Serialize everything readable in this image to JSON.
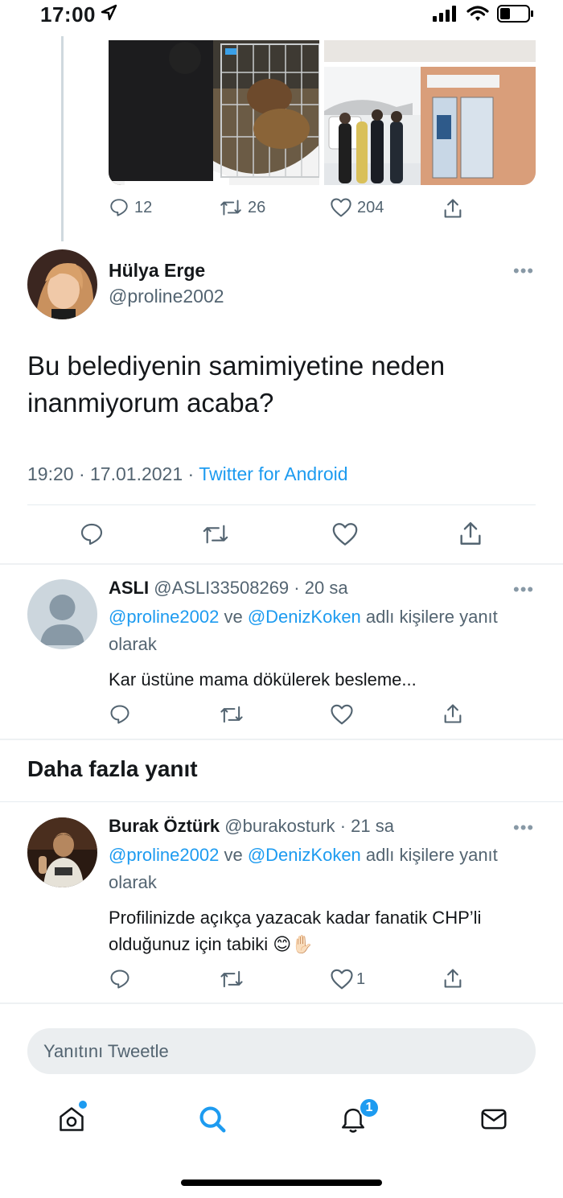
{
  "status_bar": {
    "time": "17:00"
  },
  "top_tweet": {
    "actions": {
      "replies": "12",
      "retweets": "26",
      "likes": "204"
    }
  },
  "main_tweet": {
    "author_name": "Hülya Erge",
    "author_handle": "@proline2002",
    "text": "Bu belediyenin  samimiyetine neden inanmiyorum acaba?",
    "time": "19:20",
    "date": "17.01.2021",
    "separator": "·",
    "source": "Twitter for Android"
  },
  "replies": [
    {
      "author_name": "ASLI",
      "author_handle": "@ASLI33508269",
      "time_ago": "20 sa",
      "mention_1": "@proline2002",
      "joiner": "ve",
      "mention_2": "@DenizKoken",
      "reply_suffix": "adlı kişilere yanıt olarak",
      "text": "Kar üstüne mama dökülerek besleme...",
      "likes": ""
    },
    {
      "author_name": "Burak Öztürk",
      "author_handle": "@burakosturk",
      "time_ago": "21 sa",
      "mention_1": "@proline2002",
      "joiner": "ve",
      "mention_2": "@DenizKoken",
      "reply_suffix": "adlı kişilere yanıt olarak",
      "text": "Profilinizde açıkça yazacak kadar fanatik CHP’li olduğunuz için tabiki 😊✋🏻",
      "likes": "1"
    }
  ],
  "more_replies_title": "Daha fazla yanıt",
  "reply_input": {
    "placeholder": "Yanıtını Tweetle"
  },
  "tabbar": {
    "notifications_badge": "1"
  },
  "colors": {
    "accent": "#1d9bf0",
    "muted": "#536471",
    "text": "#14171a"
  },
  "icons": [
    "location-arrow-icon",
    "signal-icon",
    "wifi-icon",
    "battery-icon",
    "reply-icon",
    "retweet-icon",
    "like-icon",
    "share-icon",
    "more-icon",
    "home-icon",
    "search-icon",
    "bell-icon",
    "mail-icon"
  ]
}
